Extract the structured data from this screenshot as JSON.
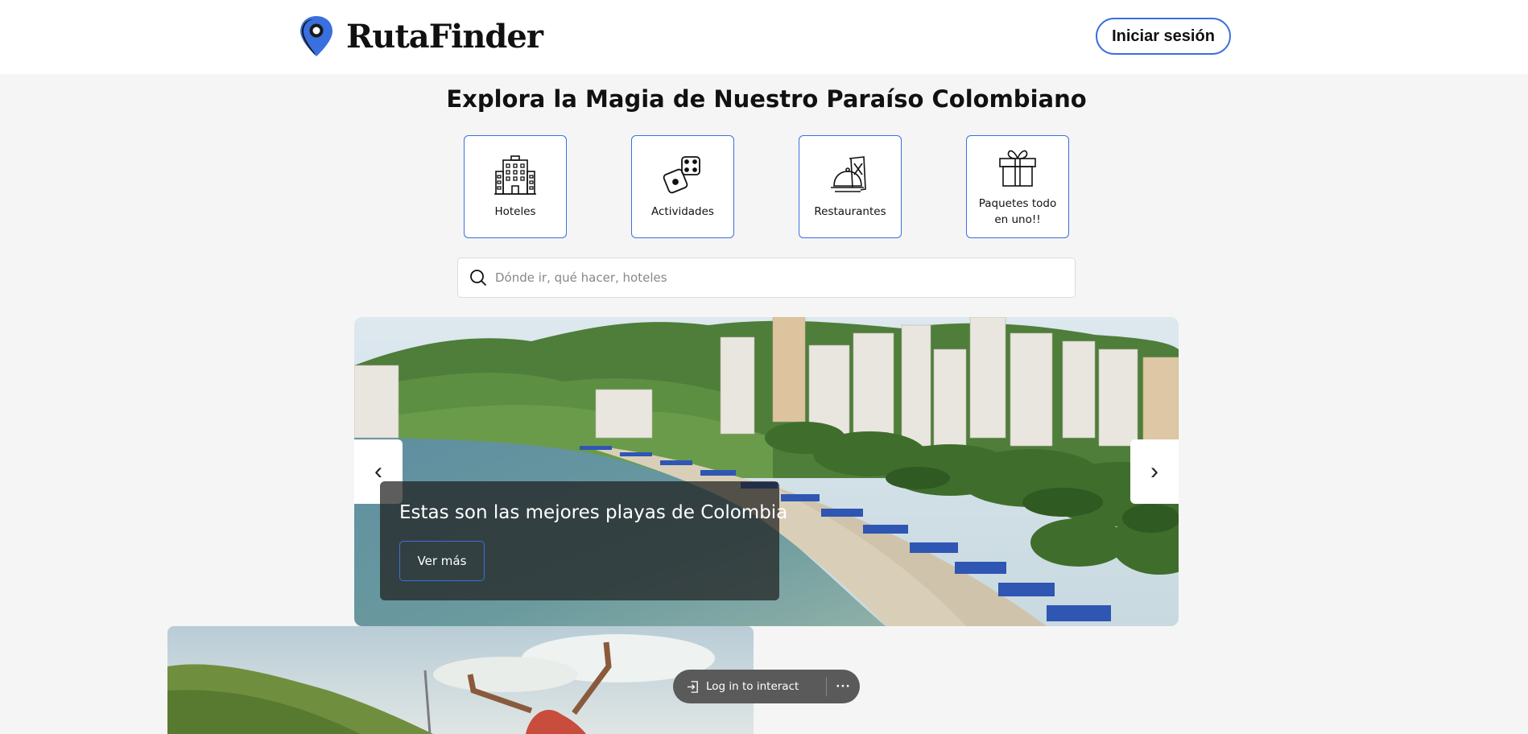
{
  "header": {
    "brand": "RutaFinder",
    "login_label": "Iniciar sesión"
  },
  "hero": {
    "title": "Explora la Magia de Nuestro Paraíso Colombiano"
  },
  "categories": [
    {
      "label": "Hoteles",
      "icon": "hotel-icon"
    },
    {
      "label": "Actividades",
      "icon": "dice-icon"
    },
    {
      "label": "Restaurantes",
      "icon": "restaurant-icon"
    },
    {
      "label": "Paquetes todo en uno!!",
      "icon": "gift-icon"
    }
  ],
  "search": {
    "placeholder": "Dónde ir, qué hacer, hoteles"
  },
  "carousel": {
    "prev_label": "‹",
    "next_label": "›",
    "caption_title": "Estas son las mejores playas de Colombia",
    "see_more_label": "Ver más"
  },
  "toast": {
    "label": "Log in to interact",
    "more_label": "···"
  },
  "colors": {
    "accent": "#3a6fe0",
    "background": "#f5f5f5"
  }
}
